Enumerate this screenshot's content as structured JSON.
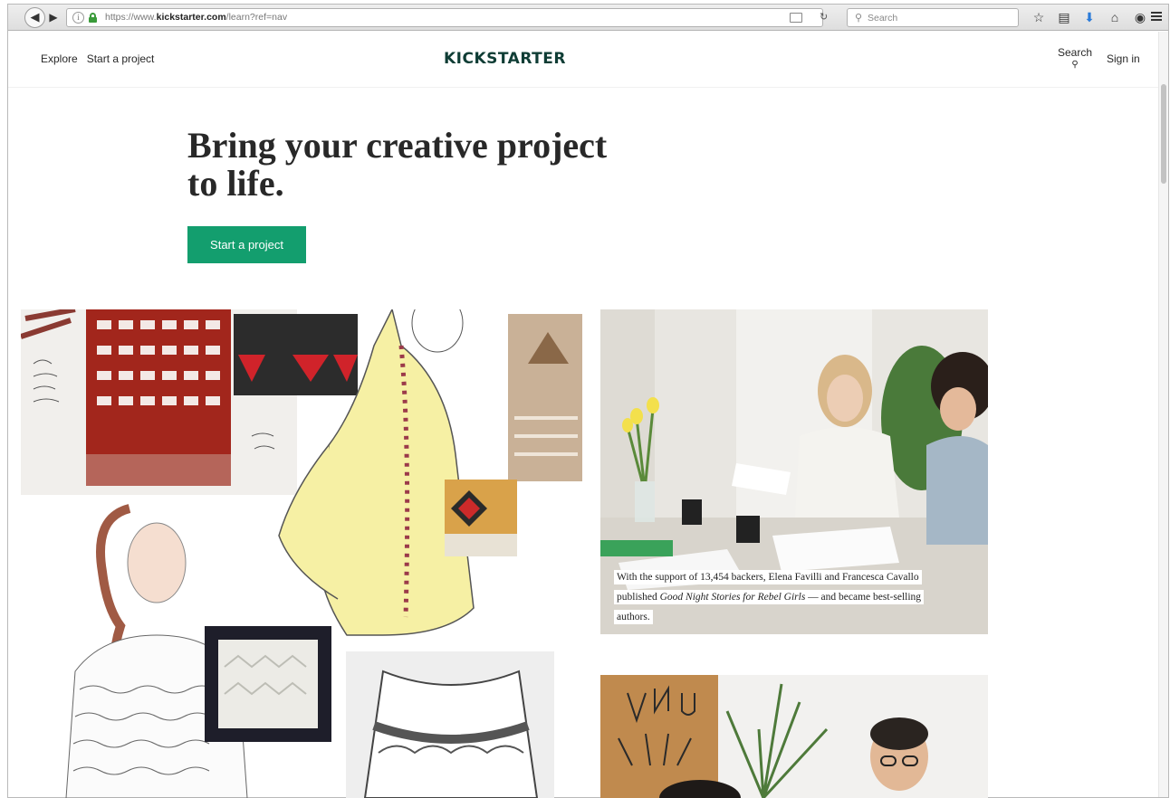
{
  "browser": {
    "url_prefix": "https://www.",
    "url_domain": "kickstarter.com",
    "url_path": "/learn?ref=nav",
    "search_placeholder": "Search"
  },
  "header": {
    "nav": [
      "Explore",
      "Start a project"
    ],
    "logo": "KICKSTARTER",
    "search_label": "Search",
    "signin_label": "Sign in"
  },
  "hero": {
    "title_line1": "Bring your creative project",
    "title_line2": "to life.",
    "cta_label": "Start a project"
  },
  "caption": {
    "line1": "With the support of 13,454 backers, Elena Favilli and Francesca Cavallo",
    "line2_pre": "published ",
    "line2_em": "Good Night Stories for Rebel Girls",
    "line2_post": " — and became best-selling",
    "line3": "authors."
  },
  "colors": {
    "brand": "#0f3d35",
    "cta": "#139e6e"
  }
}
